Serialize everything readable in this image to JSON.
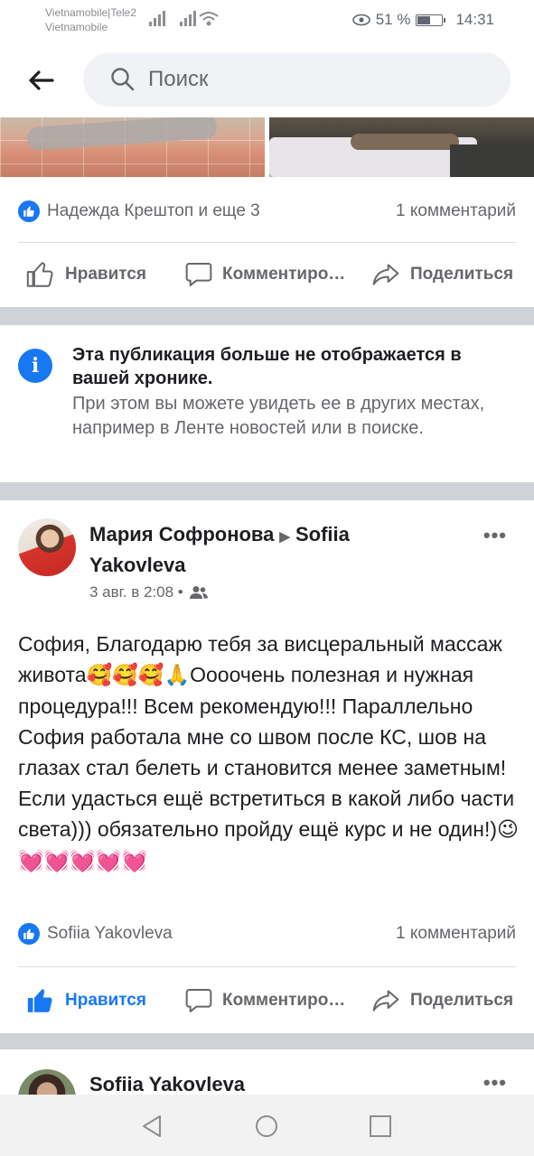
{
  "status_bar": {
    "carrier_line1": "Vietnamobile|Tele2",
    "carrier_line2": "Vietnamobile",
    "battery": "51 %",
    "time": "14:31"
  },
  "header": {
    "search_placeholder": "Поиск"
  },
  "post1": {
    "reaction_names": "Надежда Крештоп и еще 3",
    "comments": "1 комментарий",
    "actions": {
      "like": "Нравится",
      "comment": "Комментиро…",
      "share": "Поделиться"
    }
  },
  "notice": {
    "title": "Эта публикация больше не отображается в вашей хронике.",
    "body": "При этом вы можете увидеть ее в других местах, например в Ленте новостей или в поиске."
  },
  "post2": {
    "author": "Мария Софронова",
    "target": "Sofiia Yakovleva",
    "meta": "3 авг. в 2:08 •",
    "text_main": "София, Благодарю тебя за висцеральный массаж живота",
    "emoji1": "🥰🥰🥰🙏",
    "text_cont": "Оооочень полезная и нужная процедура!!! Всем рекомендую!!! Параллельно София работала мне со швом после КС, шов на глазах стал белеть и становится менее заметным! Если удасться ещё встретиться в какой либо части света))) обязательно пройду ещё курс и не один!)",
    "emoji2": "😉💓💓💓💓💓",
    "reaction_names": "Sofiia Yakovleva",
    "comments": "1 комментарий",
    "actions": {
      "like": "Нравится",
      "comment": "Комментиро…",
      "share": "Поделиться"
    },
    "colors": {
      "liked": "#1877f2"
    }
  },
  "post3": {
    "author": "Sofiia Yakovleva"
  }
}
